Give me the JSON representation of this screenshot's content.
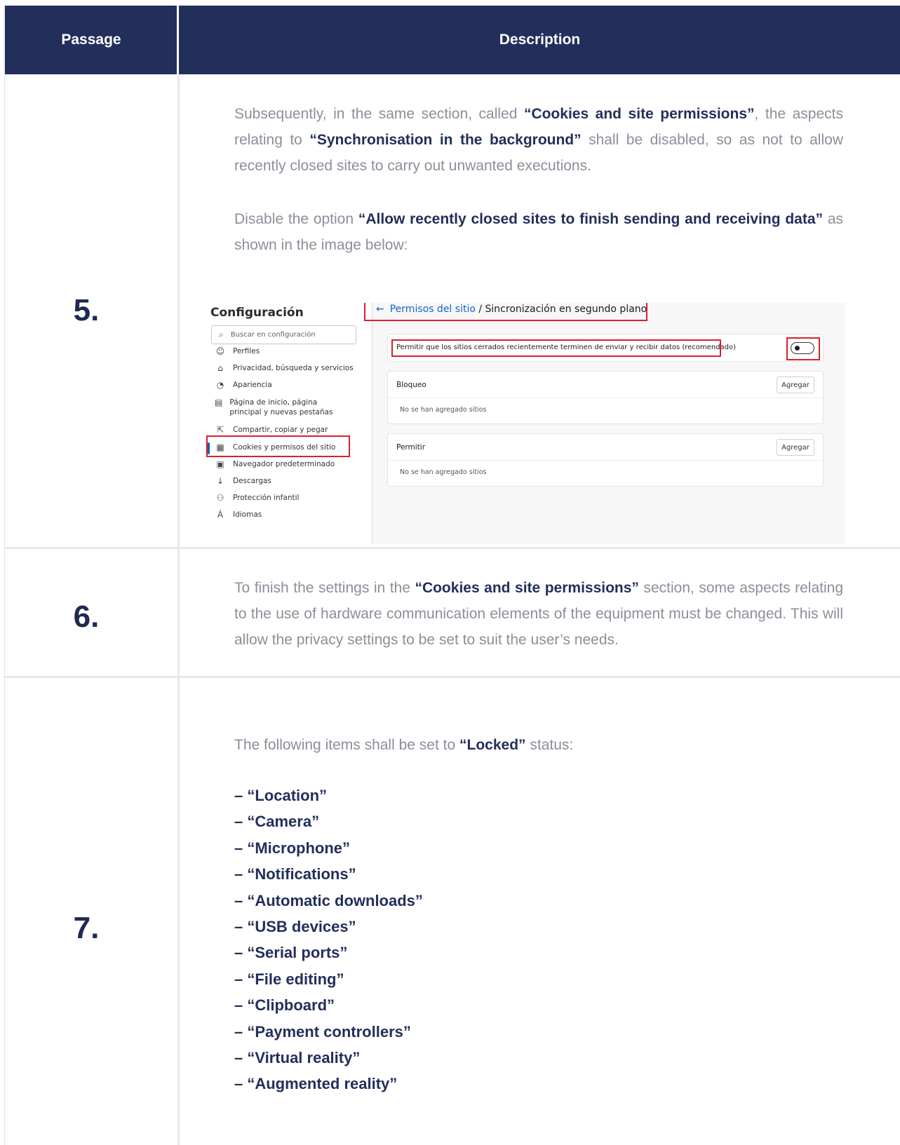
{
  "header": {
    "passage_label": "Passage",
    "description_label": "Description"
  },
  "rows": [
    {
      "number": "5.",
      "paragraphs": [
        {
          "p1_a": "Subsequently, in the same section, called ",
          "p1_b": "“Cookies and site permissions”",
          "p1_c": ", the aspects relating to ",
          "p1_d": "“Synchronisation in the background”",
          "p1_e": " shall be disabled, so as not to allow recently closed sites to carry out unwanted executions."
        },
        {
          "p2_a": "Disable the option ",
          "p2_b": "“Allow recently closed sites to finish sending and receiving data”",
          "p2_c": " as shown in the image below:"
        }
      ]
    },
    {
      "number": "6.",
      "p_a": "To finish the settings in the ",
      "p_b": "“Cookies and site permissions”",
      "p_c": " section, some aspects relating to the use of hardware communication elements of the equipment must be changed. This will allow the privacy settings to be set to suit the user’s needs."
    },
    {
      "number": "7.",
      "p_a": "The following items shall be set to ",
      "p_b": "“Locked”",
      "p_c": " status:",
      "items": [
        "– “Location”",
        "– “Camera”",
        "– “Microphone”",
        "– “Notifications”",
        "– “Automatic downloads”",
        "– “USB devices”",
        "– “Serial ports”",
        "– “File editing”",
        "– “Clipboard”",
        "– “Payment controllers”",
        "– “Virtual reality”",
        "– “Augmented reality”"
      ]
    }
  ],
  "screenshot": {
    "title": "Configuración",
    "search_placeholder": "Buscar en configuración",
    "nav": [
      {
        "icon": "profile-icon",
        "label": "Perfiles"
      },
      {
        "icon": "lock-icon",
        "label": "Privacidad, búsqueda y servicios"
      },
      {
        "icon": "palette-icon",
        "label": "Apariencia"
      },
      {
        "icon": "home-page-icon",
        "label": "Página de inicio, página principal y nuevas pestañas"
      },
      {
        "icon": "share-icon",
        "label": "Compartir, copiar y pegar"
      },
      {
        "icon": "cookies-icon",
        "label": "Cookies y permisos del sitio"
      },
      {
        "icon": "browser-icon",
        "label": "Navegador predeterminado"
      },
      {
        "icon": "download-icon",
        "label": "Descargas"
      },
      {
        "icon": "family-icon",
        "label": "Protección infantil"
      },
      {
        "icon": "language-icon",
        "label": "Idiomas"
      }
    ],
    "breadcrumb_link": "Permisos del sitio",
    "breadcrumb_current": " / Sincronización en segundo plano",
    "toggle_label": "Permitir que los sitios cerrados recientemente terminen de enviar y recibir datos (recomendado)",
    "block_title": "Bloqueo",
    "allow_title": "Permitir",
    "add_label": "Agregar",
    "empty_text": "No se han agregado sitios"
  }
}
